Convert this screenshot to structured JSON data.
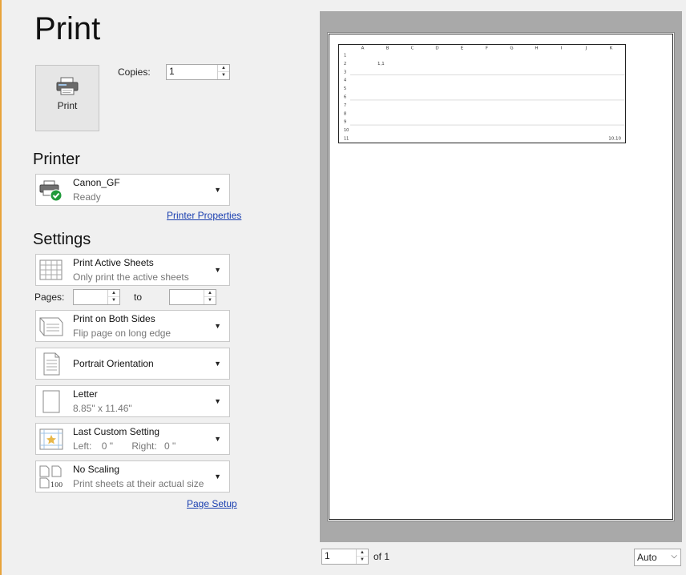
{
  "title": "Print",
  "print_button": {
    "label": "Print",
    "icon": "printer-icon"
  },
  "copies": {
    "label": "Copies:",
    "value": "1"
  },
  "printer": {
    "section_title": "Printer",
    "name": "Canon_GF",
    "status": "Ready",
    "properties_link": "Printer Properties"
  },
  "settings": {
    "section_title": "Settings",
    "what": {
      "title": "Print Active Sheets",
      "subtitle": "Only print the active sheets"
    },
    "pages": {
      "label": "Pages:",
      "to_label": "to",
      "from": "",
      "to": ""
    },
    "sides": {
      "title": "Print on Both Sides",
      "subtitle": "Flip page on long edge"
    },
    "orientation": {
      "title": "Portrait Orientation"
    },
    "paper": {
      "title": "Letter",
      "subtitle": "8.85\" x 11.46\""
    },
    "margins": {
      "title": "Last Custom Setting",
      "left_label": "Left:",
      "left_value": "0 \"",
      "right_label": "Right:",
      "right_value": "0 \""
    },
    "scaling": {
      "title": "No Scaling",
      "subtitle": "Print sheets at their actual size",
      "icon_text": "100"
    },
    "page_setup_link": "Page Setup"
  },
  "preview": {
    "columns": [
      "A",
      "B",
      "C",
      "D",
      "E",
      "F",
      "G",
      "H",
      "I",
      "J",
      "K"
    ],
    "rows": [
      "1",
      "2",
      "3",
      "4",
      "5",
      "6",
      "7",
      "8",
      "9",
      "10",
      "11"
    ],
    "cells": [
      {
        "row": 2,
        "col": 2,
        "text": "1,1"
      },
      {
        "row": 11,
        "col": 11,
        "text": "10,10"
      }
    ]
  },
  "navigation": {
    "page_value": "1",
    "of_label": "of 1"
  },
  "zoom": {
    "value": "Auto"
  },
  "colors": {
    "accent": "#e8a33a",
    "link": "#1a3fb0",
    "ok_green": "#1f9a3a"
  }
}
